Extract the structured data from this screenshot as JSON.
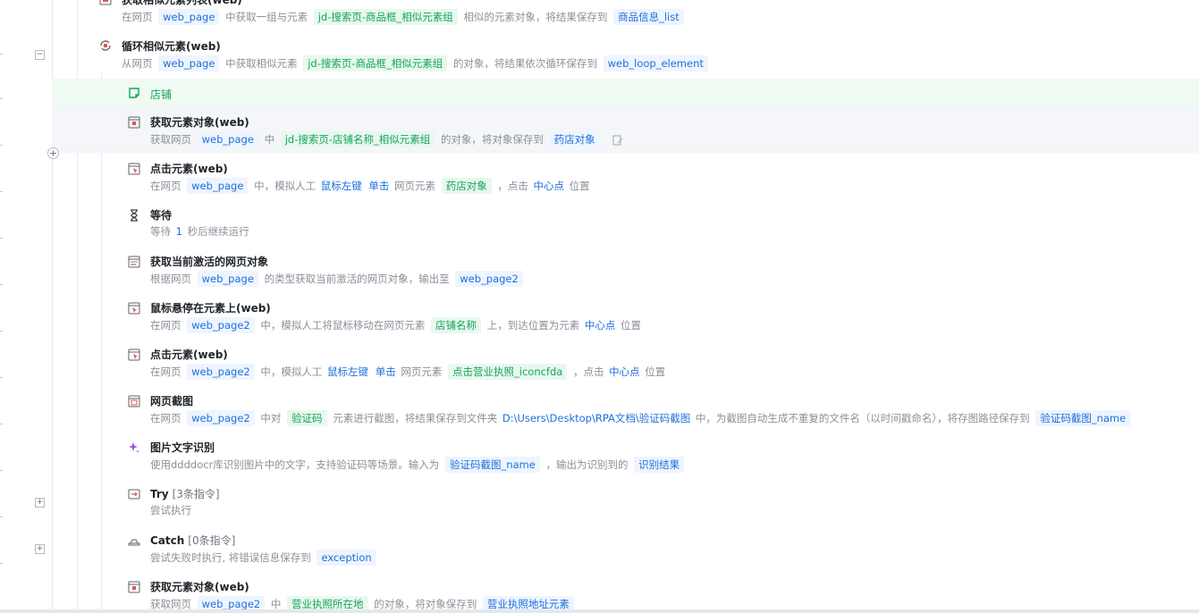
{
  "colors": {
    "accent": "#1e6fdc",
    "green": "#13a45a",
    "muted": "#8a9099"
  },
  "rows": {
    "r0": {
      "title": "获取相似元素列表(web)",
      "d": [
        "在网页",
        "web_page",
        "中获取一组与元素",
        "jd-搜索页-商品框_相似元素组",
        "相似的元素对象，将结果保存到",
        "商品信息_list"
      ]
    },
    "r1": {
      "title": "循环相似元素(web)",
      "d": [
        "从网页",
        "web_page",
        "中获取相似元素",
        "jd-搜索页-商品框_相似元素组",
        "的对象，将结果依次循环保存到",
        "web_loop_element"
      ]
    },
    "r2": {
      "comment": "店铺"
    },
    "r3": {
      "title": "获取元素对象(web)",
      "d": [
        "获取网页",
        "web_page",
        "中",
        "jd-搜索页-店铺名称_相似元素组",
        "的对象，将对象保存到",
        "药店对象"
      ]
    },
    "r4": {
      "title": "点击元素(web)",
      "d": [
        "在网页",
        "web_page",
        "中，模拟人工",
        "鼠标左键",
        "单击",
        "网页元素",
        "药店对象",
        "，点击",
        "中心点",
        "位置"
      ]
    },
    "r5": {
      "title": "等待",
      "d": [
        "等待",
        "1",
        "秒后继续运行"
      ]
    },
    "r6": {
      "title": "获取当前激活的网页对象",
      "d": [
        "根据网页",
        "web_page",
        "的类型获取当前激活的网页对象，输出至",
        "web_page2"
      ]
    },
    "r7": {
      "title": "鼠标悬停在元素上(web)",
      "d": [
        "在网页",
        "web_page2",
        "中，模拟人工将鼠标移动在网页元素",
        "店铺名称",
        "上，到达位置为元素",
        "中心点",
        "位置"
      ]
    },
    "r8": {
      "title": "点击元素(web)",
      "d": [
        "在网页",
        "web_page2",
        "中，模拟人工",
        "鼠标左键",
        "单击",
        "网页元素",
        "点击营业执照_iconcfda",
        "，点击",
        "中心点",
        "位置"
      ]
    },
    "r9": {
      "title": "网页截图",
      "d": [
        "在网页",
        "web_page2",
        "中对",
        "验证码",
        "元素进行截图，将结果保存到文件夹",
        "D:\\Users\\Desktop\\RPA文档\\验证码截图",
        "中，为截图自动生成不重复的文件名（以时间戳命名），将存图路径保存到",
        "验证码截图_name"
      ]
    },
    "r10": {
      "title": "图片文字识别",
      "d": [
        "使用ddddocr库识别图片中的文字，支持验证码等场景。输入为",
        "验证码截图_name",
        "，输出为识别到的",
        "识别结果"
      ]
    },
    "r11": {
      "title": "Try",
      "count": "[3条指令]",
      "d": [
        "尝试执行"
      ]
    },
    "r12": {
      "title": "Catch",
      "count": "[0条指令]",
      "d": [
        "尝试失败时执行, 将错误信息保存到",
        "exception"
      ]
    },
    "r13": {
      "title": "获取元素对象(web)",
      "d": [
        "获取网页",
        "web_page2",
        "中",
        "营业执照所在地",
        "的对象，将对象保存到",
        "营业执照地址元素"
      ]
    }
  },
  "expanders": {
    "minus": "−",
    "plus": "+"
  }
}
